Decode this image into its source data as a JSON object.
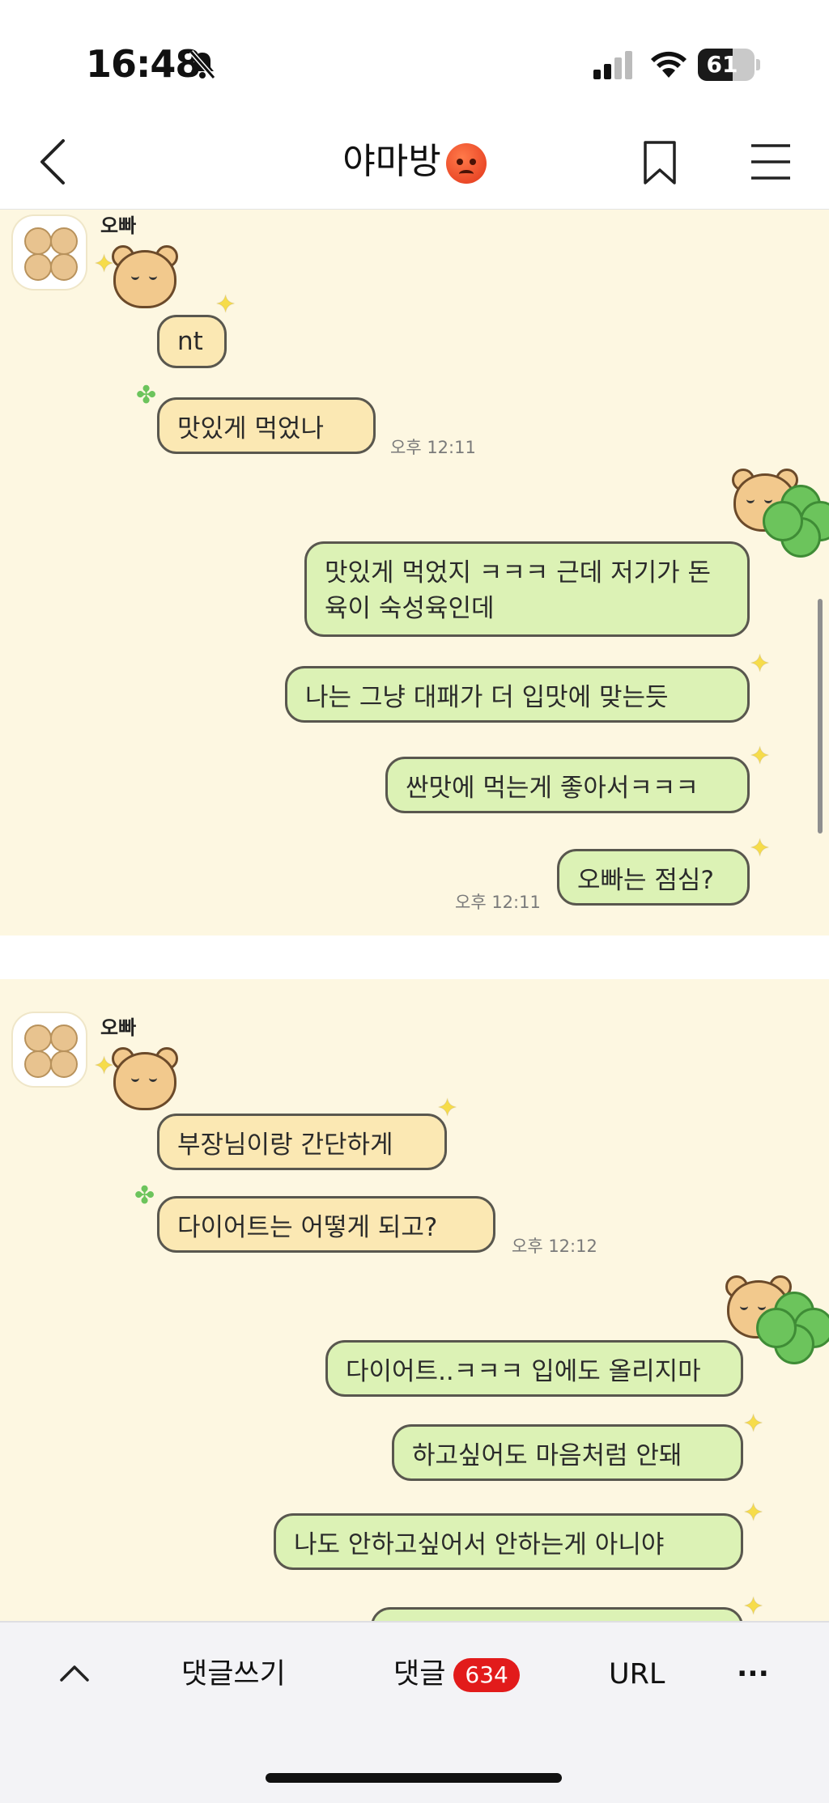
{
  "status_bar": {
    "time": "16:48",
    "battery": "61",
    "battery_level": 0.61
  },
  "header": {
    "title": "야마방",
    "emoji_icon": "angry-face-icon"
  },
  "chat": {
    "panel1": {
      "sender": "오빠",
      "incoming": [
        "nt",
        "맛있게 먹었나"
      ],
      "incoming_time": "오후 12:11",
      "outgoing": [
        "맛있게 먹었지 ㅋㅋㅋ 근데 저기가 돈육이 숙성육인데",
        "나는 그냥 대패가 더 입맛에 맞는듯",
        "싼맛에 먹는게 좋아서ㅋㅋㅋ",
        "오빠는 점심?"
      ],
      "outgoing_time": "오후 12:11"
    },
    "panel2": {
      "sender": "오빠",
      "incoming": [
        "부장님이랑 간단하게",
        "다이어트는 어떻게 되고?"
      ],
      "incoming_time": "오후 12:12",
      "outgoing": [
        "다이어트..ㅋㅋㅋ 입에도 올리지마",
        "하고싶어도 마음처럼 안돼",
        "나도 안하고싶어서 안하는게 아니야"
      ]
    }
  },
  "toolbar": {
    "write_comment": "댓글쓰기",
    "comments_label": "댓글",
    "comments_count": "634",
    "url_label": "URL",
    "more": "···"
  },
  "colors": {
    "chat_bg": "#fdf7e1",
    "incoming_bubble": "#fbe8b3",
    "outgoing_bubble": "#dcf2b5",
    "badge": "#e21b1b"
  }
}
